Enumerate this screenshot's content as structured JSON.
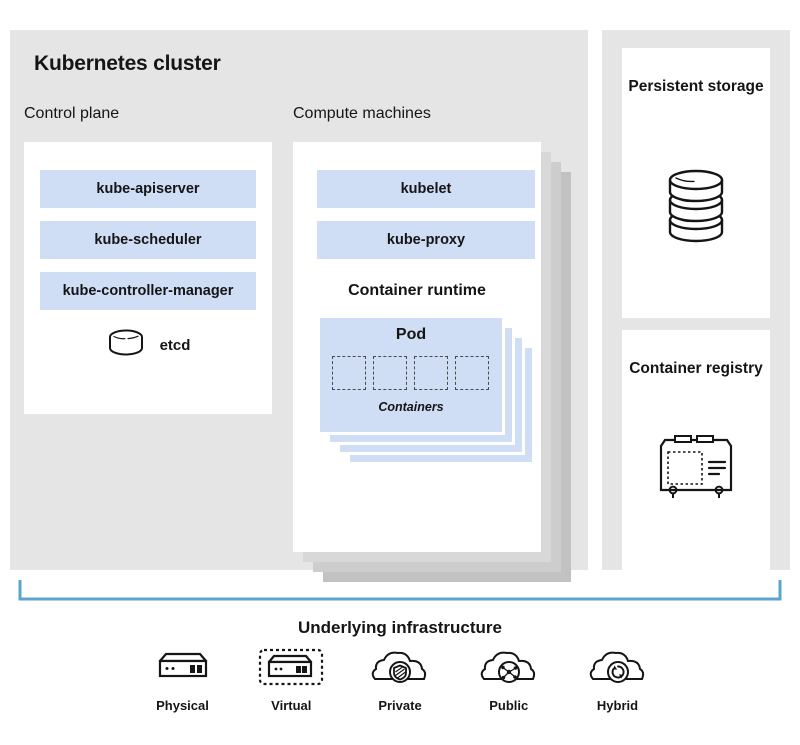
{
  "cluster": {
    "title": "Kubernetes cluster",
    "control_plane": {
      "heading": "Control plane",
      "components": [
        {
          "label": "kube-apiserver"
        },
        {
          "label": "kube-scheduler"
        },
        {
          "label": "kube-controller-manager"
        }
      ],
      "etcd_label": "etcd",
      "etcd_icon": "database-cylinder-icon"
    },
    "compute_machines": {
      "heading": "Compute machines",
      "components": [
        {
          "label": "kubelet"
        },
        {
          "label": "kube-proxy"
        }
      ],
      "runtime_label": "Container runtime",
      "pod": {
        "title": "Pod",
        "containers_label": "Containers",
        "container_count": 4,
        "stack_copies": 3
      },
      "stack_copies": 3
    }
  },
  "side_panels": [
    {
      "title": "Persistent storage",
      "icon": "database-stack-icon"
    },
    {
      "title": "Container registry",
      "icon": "container-crate-icon"
    }
  ],
  "infrastructure": {
    "title": "Underlying infrastructure",
    "bracket_icon": "bracket-icon",
    "items": [
      {
        "label": "Physical",
        "icon": "server-icon"
      },
      {
        "label": "Virtual",
        "icon": "virtual-server-icon"
      },
      {
        "label": "Private",
        "icon": "cloud-shield-icon"
      },
      {
        "label": "Public",
        "icon": "cloud-network-icon"
      },
      {
        "label": "Hybrid",
        "icon": "cloud-sync-icon"
      }
    ]
  },
  "colors": {
    "panel_background": "#e5e5e5",
    "card_background": "#ffffff",
    "component_blue": "#cfdef4",
    "bracket_blue": "#5ba4cf",
    "text": "#151515"
  }
}
